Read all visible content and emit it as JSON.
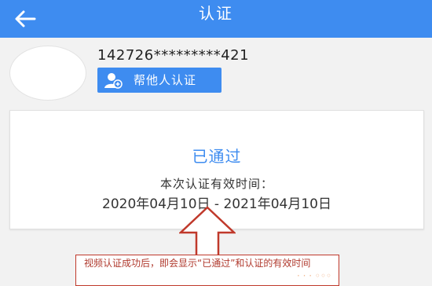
{
  "header": {
    "title": "认证"
  },
  "profile": {
    "id_masked": "142726*********421",
    "help_button_label": "帮他人认证"
  },
  "status_card": {
    "status": "已通过",
    "validity_label": "本次认证有效时间：",
    "validity_range": "2020年04月10日 - 2021年04月10日"
  },
  "annotation": {
    "text": "视频认证成功后，即会显示“已通过”和认证的有效时间"
  },
  "colors": {
    "primary": "#3e8cf0",
    "annotation_red": "#b03a2e",
    "background": "#f2f2f2"
  },
  "icons": {
    "back": "arrow-left-icon",
    "help": "user-verify-icon"
  }
}
